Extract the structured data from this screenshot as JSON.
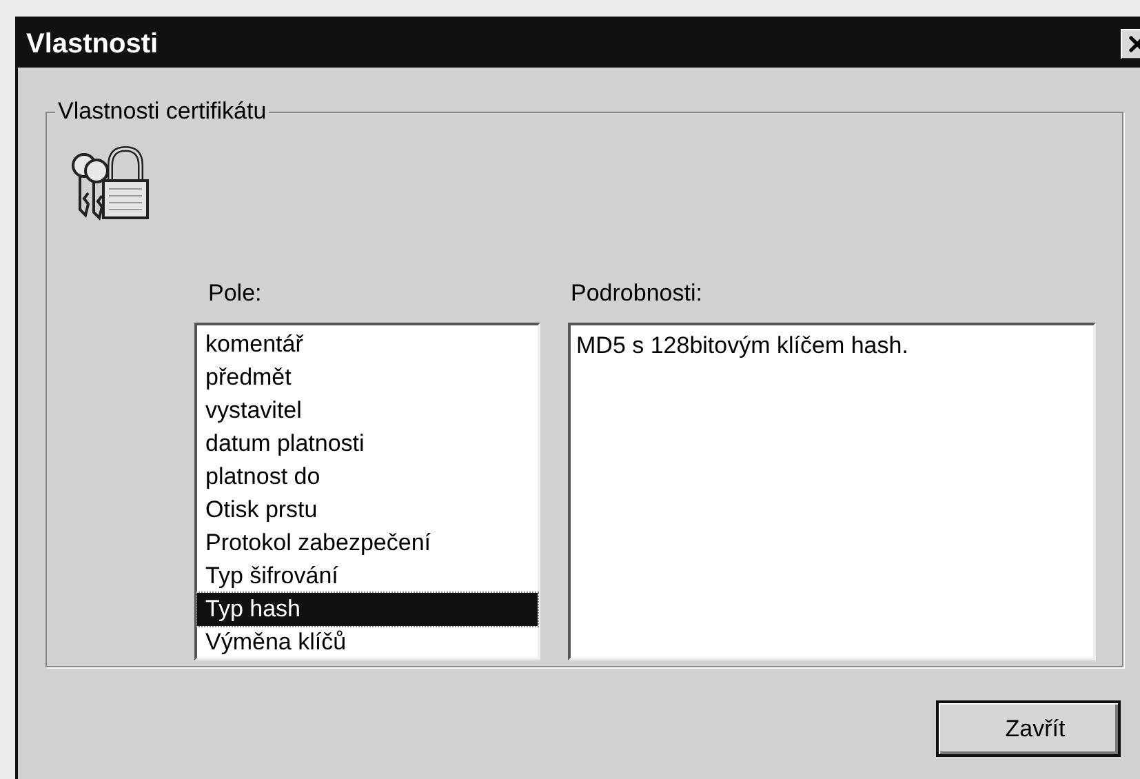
{
  "window": {
    "title": "Vlastnosti"
  },
  "group": {
    "title": "Vlastnosti certifikátu"
  },
  "fields": {
    "label": "Pole:",
    "items": [
      {
        "label": "komentář",
        "selected": false
      },
      {
        "label": "předmět",
        "selected": false
      },
      {
        "label": "vystavitel",
        "selected": false
      },
      {
        "label": "datum platnosti",
        "selected": false
      },
      {
        "label": "platnost do",
        "selected": false
      },
      {
        "label": "Otisk prstu",
        "selected": false
      },
      {
        "label": "Protokol zabezpečení",
        "selected": false
      },
      {
        "label": "Typ šifrování",
        "selected": false
      },
      {
        "label": "Typ hash",
        "selected": true
      },
      {
        "label": "Výměna klíčů",
        "selected": false
      }
    ]
  },
  "details": {
    "label": "Podrobnosti:",
    "value": "MD5 s 128bitovým klíčem hash."
  },
  "buttons": [
    {
      "label": "Zavřít"
    }
  ]
}
